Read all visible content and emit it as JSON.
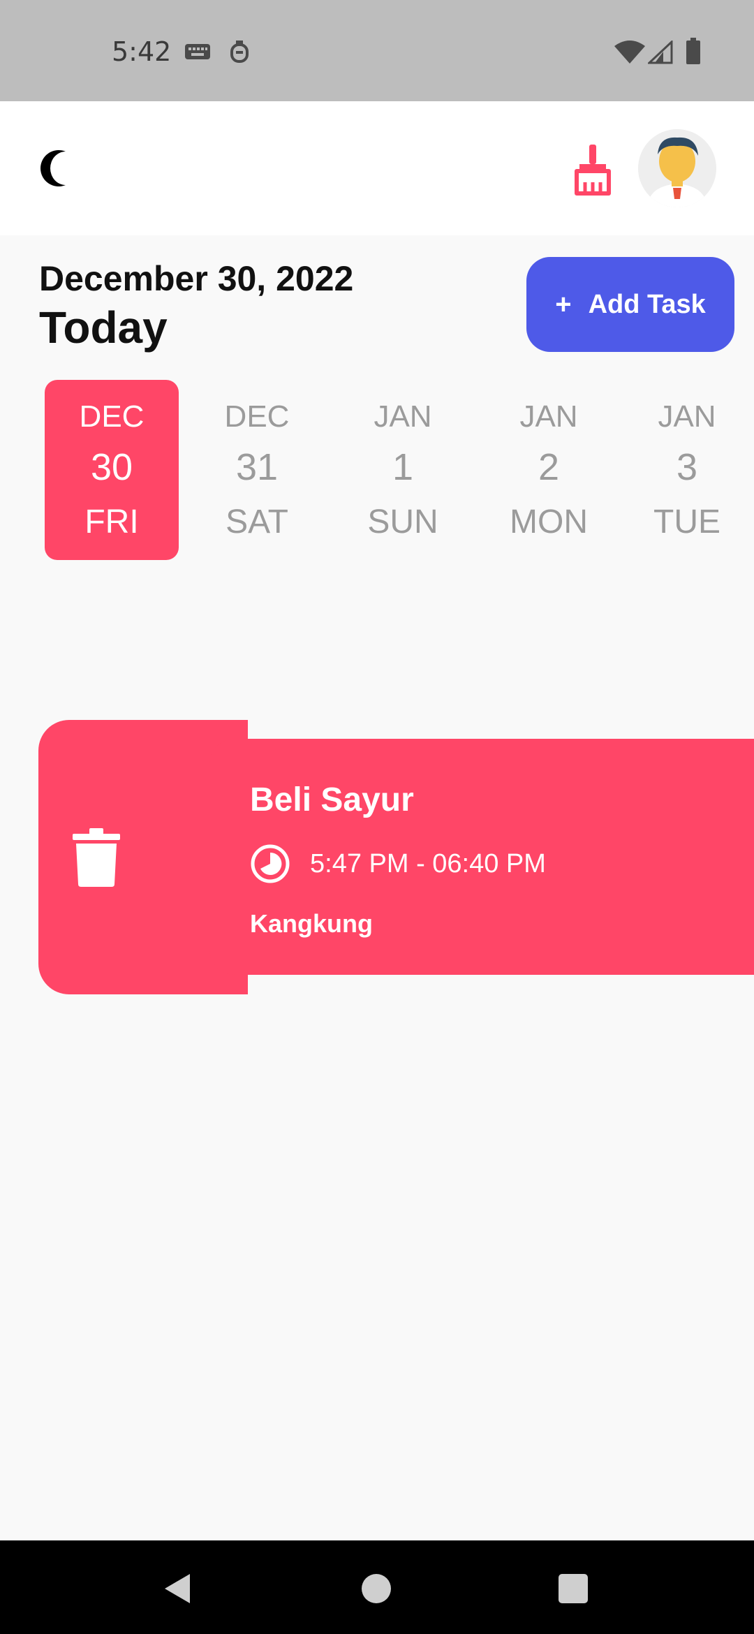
{
  "status_bar": {
    "time": "5:42",
    "icons": [
      "keyboard-icon",
      "accessibility-icon",
      "wifi-icon",
      "cell-signal-icon",
      "battery-icon"
    ]
  },
  "app_bar": {
    "left_icon": "moon-icon",
    "right_icons": [
      "broom-icon",
      "avatar"
    ]
  },
  "header": {
    "date": "December 30, 2022",
    "title": "Today",
    "add_button": {
      "plus": "+",
      "label": "Add Task"
    }
  },
  "date_picker": {
    "items": [
      {
        "month": "DEC",
        "day": "30",
        "weekday": "FRI",
        "selected": true
      },
      {
        "month": "DEC",
        "day": "31",
        "weekday": "SAT",
        "selected": false
      },
      {
        "month": "JAN",
        "day": "1",
        "weekday": "SUN",
        "selected": false
      },
      {
        "month": "JAN",
        "day": "2",
        "weekday": "MON",
        "selected": false
      },
      {
        "month": "JAN",
        "day": "3",
        "weekday": "TUE",
        "selected": false
      }
    ]
  },
  "tasks": [
    {
      "title": "Beli Sayur",
      "time": "5:47 PM - 06:40 PM",
      "note": "Kangkung",
      "color": "#ff4667"
    }
  ],
  "colors": {
    "accent": "#4e5ae8",
    "selected": "#ff4667",
    "task": "#ff4667"
  },
  "nav_bar": {
    "icons": [
      "back-icon",
      "home-icon",
      "recents-icon"
    ]
  }
}
